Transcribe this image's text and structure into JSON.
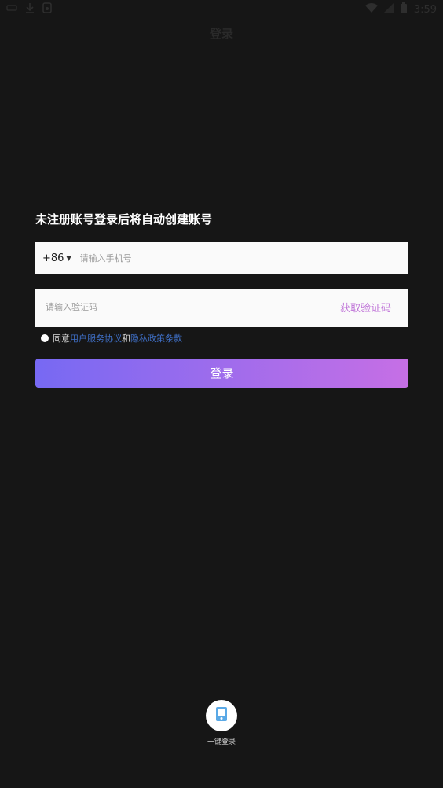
{
  "status_bar": {
    "time": "3:59"
  },
  "header": {
    "title": "登录"
  },
  "form": {
    "heading": "未注册账号登录后将自动创建账号",
    "country_code": "+86",
    "phone_placeholder": "请输入手机号",
    "code_placeholder": "请输入验证码",
    "get_code_label": "获取验证码",
    "agree_prefix": "同意",
    "user_agreement": "用户服务协议",
    "conjunction": "和",
    "privacy_policy": "隐私政策条款",
    "login_label": "登录"
  },
  "one_key": {
    "label": "一键登录"
  },
  "colors": {
    "background": "#161616",
    "accent": "#c075d8",
    "link": "#3f6fc6",
    "gradient_start": "#7769f3",
    "gradient_end": "#c66fe5"
  }
}
